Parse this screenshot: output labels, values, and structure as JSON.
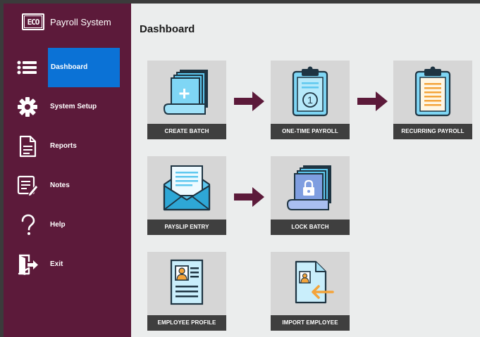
{
  "app": {
    "logo_text": "ECO",
    "name": "Payroll System"
  },
  "sidebar": {
    "items": [
      {
        "label": "Dashboard",
        "icon": "menu-icon",
        "active": true
      },
      {
        "label": "System Setup",
        "icon": "gear-icon",
        "active": false
      },
      {
        "label": "Reports",
        "icon": "document-icon",
        "active": false
      },
      {
        "label": "Notes",
        "icon": "notes-edit-icon",
        "active": false
      },
      {
        "label": "Help",
        "icon": "question-icon",
        "active": false
      },
      {
        "label": "Exit",
        "icon": "exit-door-icon",
        "active": false
      }
    ]
  },
  "main": {
    "title": "Dashboard",
    "tiles": [
      {
        "label": "CREATE BATCH",
        "icon": "create-batch-icon"
      },
      {
        "label": "ONE-TIME PAYROLL",
        "icon": "one-time-clipboard-icon"
      },
      {
        "label": "RECURRING PAYROLL",
        "icon": "recurring-clipboard-icon"
      },
      {
        "label": "PAYSLIP ENTRY",
        "icon": "payslip-envelope-icon"
      },
      {
        "label": "LOCK BATCH",
        "icon": "lock-batch-icon"
      },
      {
        "label": "EMPLOYEE PROFILE",
        "icon": "employee-profile-icon"
      },
      {
        "label": "IMPORT EMPLOYEE",
        "icon": "import-employee-icon"
      }
    ]
  },
  "colors": {
    "sidebar_bg": "#5c1a3a",
    "active_item": "#0b72d6",
    "tile_bg": "#d6d6d6",
    "caption_bg": "#3f3f3f",
    "flow_arrow": "#5c1a3a",
    "content_bg": "#ebeded"
  }
}
